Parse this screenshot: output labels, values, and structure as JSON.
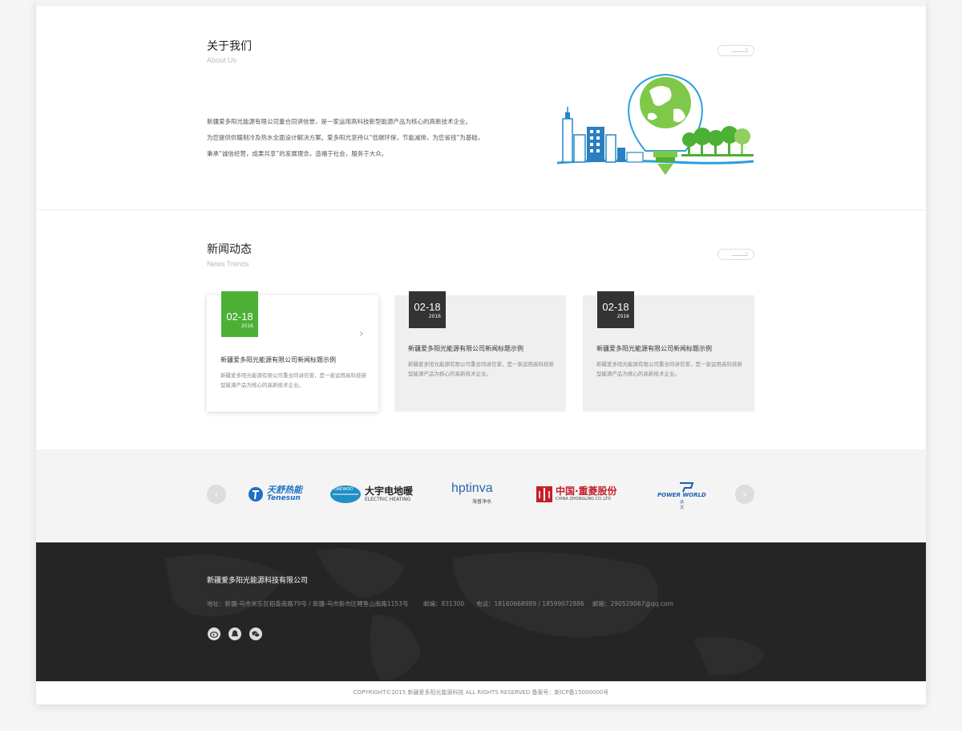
{
  "about": {
    "title": "关于我们",
    "subtitle": "About Us",
    "lines": [
      "新疆爱多阳光能源有限公司重合同讲信誉，是一家运用高科技新型能源产品为核心的高新技术企业。",
      "为您提供供暖制冷及热水全面设计解决方案。爱多阳光坚持以“低碳环保，节能减排，为您省钱”为基础，",
      "秉承“诚信经营，成果共享”的发展理念，造福于社会，服务于大众。"
    ]
  },
  "news": {
    "title": "新闻动态",
    "subtitle": "News Trends",
    "cards": [
      {
        "day": "02-18",
        "year": "2016",
        "title": "新疆爱多阳光能源有限公司新闻标题示例",
        "desc": "新疆爱多阳光能源有限公司重合同讲信誉，是一家运用高科技新型能源产品为核心的高新技术企业。"
      },
      {
        "day": "02-18",
        "year": "2016",
        "title": "新疆爱多阳光能源有限公司新闻标题示例",
        "desc": "新疆爱多阳光能源有限公司重合同讲信誉，是一家运用高科技新型能源产品为核心的高新技术企业。"
      },
      {
        "day": "02-18",
        "year": "2016",
        "title": "新疆爱多阳光能源有限公司新闻标题示例",
        "desc": "新疆爱多阳光能源有限公司重合同讲信誉，是一家运用高科技新型能源产品为核心的高新技术企业。"
      }
    ]
  },
  "partners": {
    "prev": "‹",
    "next": "›",
    "logos": [
      {
        "name": "天舒热能",
        "en": "Tenesun",
        "color": "#1f6fc4"
      },
      {
        "name": "大宇电地暖",
        "en": "ELECTRIC HEATING",
        "badge": "DAEWOO",
        "color": "#1f8fc4"
      },
      {
        "name": "hptinva",
        "en": "海普净水",
        "color": "#2a66b0"
      },
      {
        "name": "中国·重菱股份",
        "en": "CHINA ZHONGLING CO.,LTD",
        "color": "#c4202b"
      },
      {
        "name": "POWER WORLD",
        "en": "派沃",
        "color": "#1f5fb0"
      }
    ]
  },
  "footer": {
    "company": "新疆爱多阳光能源科技有限公司",
    "address": "地址：新疆-乌市米东区稻香南路79号 / 新疆-乌市新市区鲤鱼山南路1153号",
    "postcode": "邮编：831300",
    "phone": "电话：18160668989 / 18599072886",
    "email": "邮箱：290529067@qq.com",
    "copyright": "COPYRIGHT©2015 新疆爱多阳光能源科技 ALL RIGHTS RESERVED 备案号：新ICP备15000000号"
  },
  "colors": {
    "accent_green": "#4cb035",
    "dark_badge": "#333333",
    "footer_bg": "#252525"
  }
}
